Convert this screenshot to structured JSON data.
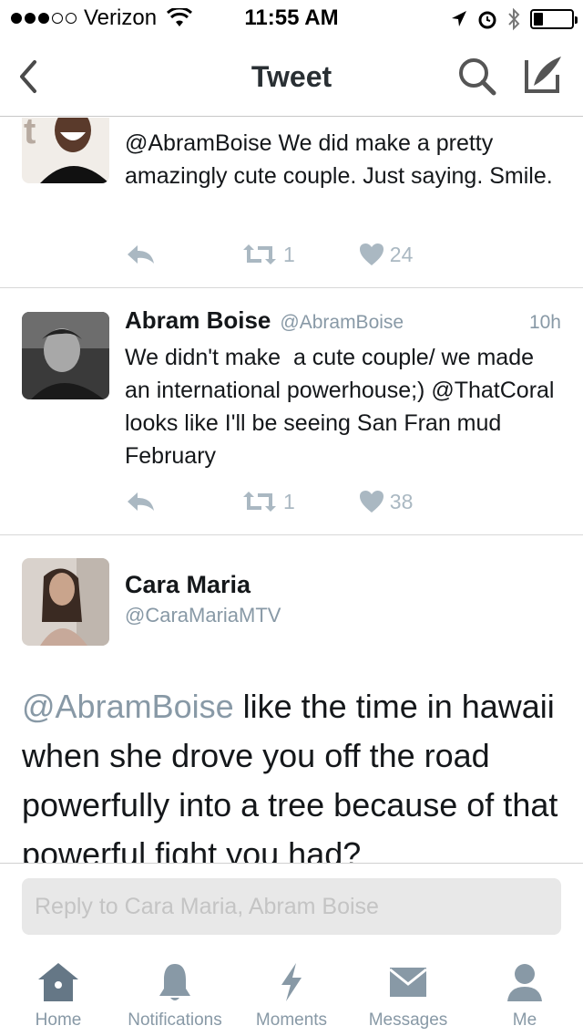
{
  "status_bar": {
    "signal_dots_filled": 3,
    "signal_dots_total": 5,
    "carrier": "Verizon",
    "time": "11:55 AM",
    "battery_level": 0.25,
    "icons": [
      "wifi-icon",
      "location-arrow-icon",
      "alarm-icon",
      "bluetooth-icon",
      "battery-icon"
    ]
  },
  "nav": {
    "title": "Tweet",
    "icons": [
      "back-chevron-icon",
      "search-icon",
      "compose-icon"
    ]
  },
  "tweets": [
    {
      "text": "@AbramBoise We did make a pretty amazingly cute couple. Just saying. Smile.",
      "retweets": "1",
      "likes": "24"
    },
    {
      "name": "Abram Boise",
      "handle": "@AbramBoise",
      "time": "10h",
      "text": "We didn't make  a cute couple/ we made an international powerhouse;) @ThatCoral looks like I'll be seeing San Fran mud February",
      "retweets": "1",
      "likes": "38"
    }
  ],
  "main_tweet": {
    "name": "Cara Maria",
    "handle": "@CaraMariaMTV",
    "mention": "@AbramBoise",
    "text": " like the time in hawaii when she drove you off the road powerfully into a tree because of that powerful fight you had?"
  },
  "reply": {
    "placeholder": "Reply to Cara Maria, Abram Boise"
  },
  "tabs": [
    {
      "label": "Home",
      "icon": "home-icon",
      "active": true
    },
    {
      "label": "Notifications",
      "icon": "bell-icon"
    },
    {
      "label": "Moments",
      "icon": "lightning-icon"
    },
    {
      "label": "Messages",
      "icon": "envelope-icon"
    },
    {
      "label": "Me",
      "icon": "person-icon"
    }
  ],
  "colors": {
    "text": "#14171a",
    "secondary": "#8899a6",
    "action_icon": "#aab8c2"
  }
}
